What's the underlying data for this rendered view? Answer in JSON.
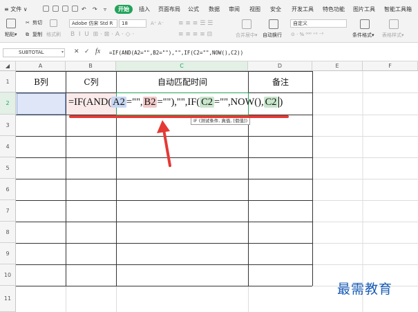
{
  "ribbon": {
    "menu_label": "≡ 文件 ∨",
    "tabs": [
      "开始",
      "插入",
      "页面布局",
      "公式",
      "数据",
      "审阅",
      "视图",
      "安全",
      "开发工具",
      "特色功能",
      "图片工具",
      "智能工具箱"
    ],
    "active_tab": "开始",
    "paste_label": "粘贴▾",
    "cut_label": "剪切",
    "copy_label": "复制",
    "format_painter_label": "格式刷",
    "font_name": "Adobe 仿宋 Std R",
    "font_size": "18",
    "merge_label": "合并居中▾",
    "wrap_label": "自动换行",
    "number_format": "自定义",
    "percent_row": "⊙ · % ⁰⁰⁰ ⁺⁰ ⁻⁰",
    "conditional_label": "条件格式▾",
    "cell_style_label": "表格样式▾"
  },
  "formula_bar": {
    "name_box": "SUBTOTAL",
    "cancel_icon": "✕",
    "confirm_icon": "✓",
    "fx_label": "fx",
    "content": "=IF(AND(A2=\"\",B2=\"\"),\"\",IF(C2=\"\",NOW(),C2))"
  },
  "grid": {
    "columns": [
      "A",
      "B",
      "C",
      "D",
      "E",
      "F"
    ],
    "rows": [
      "1",
      "2",
      "3",
      "4",
      "5",
      "6",
      "7",
      "8",
      "9",
      "10",
      "11"
    ],
    "headers": {
      "A1": "B列",
      "B1": "C列",
      "C1": "自动匹配时间",
      "D1": "备注"
    }
  },
  "editing_formula": {
    "p1": "=IF(AND(",
    "a2": "A2",
    "p2": "=\"\",",
    "b2": "B2",
    "p3": "=\"\"),\"\",IF(",
    "c2a": "C2",
    "p4": "=\"\",NOW(),",
    "c2b": "C2",
    "p5": ")"
  },
  "tooltip": "IF (测试条件, 真值, [假值])",
  "watermark": "最需教育",
  "colors": {
    "accent_green": "#22a35a",
    "ref_blue": "#c7d7f2",
    "ref_red": "#f2c9c9",
    "ref_green": "#c9e6cc",
    "annotation_red": "#e53935",
    "watermark_blue": "#1a5cb5"
  }
}
